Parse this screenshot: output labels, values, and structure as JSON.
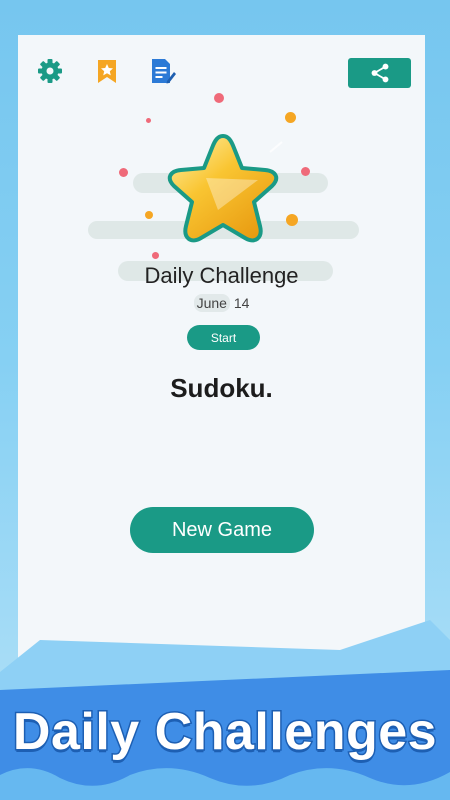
{
  "toolbar": {
    "icons": [
      "gear-icon",
      "bookmark-star-icon",
      "document-edit-icon",
      "share-icon"
    ]
  },
  "challenge": {
    "title": "Daily Challenge",
    "date_month": "June",
    "date_day": "14",
    "start_label": "Start"
  },
  "game": {
    "title": "Sudoku.",
    "new_game_label": "New Game"
  },
  "banner": {
    "text": "Daily Challenges"
  },
  "colors": {
    "accent": "#1a9a86",
    "background": "#76c6ef",
    "banner_blue": "#3f8de6",
    "star_gold": "#f5b928"
  }
}
